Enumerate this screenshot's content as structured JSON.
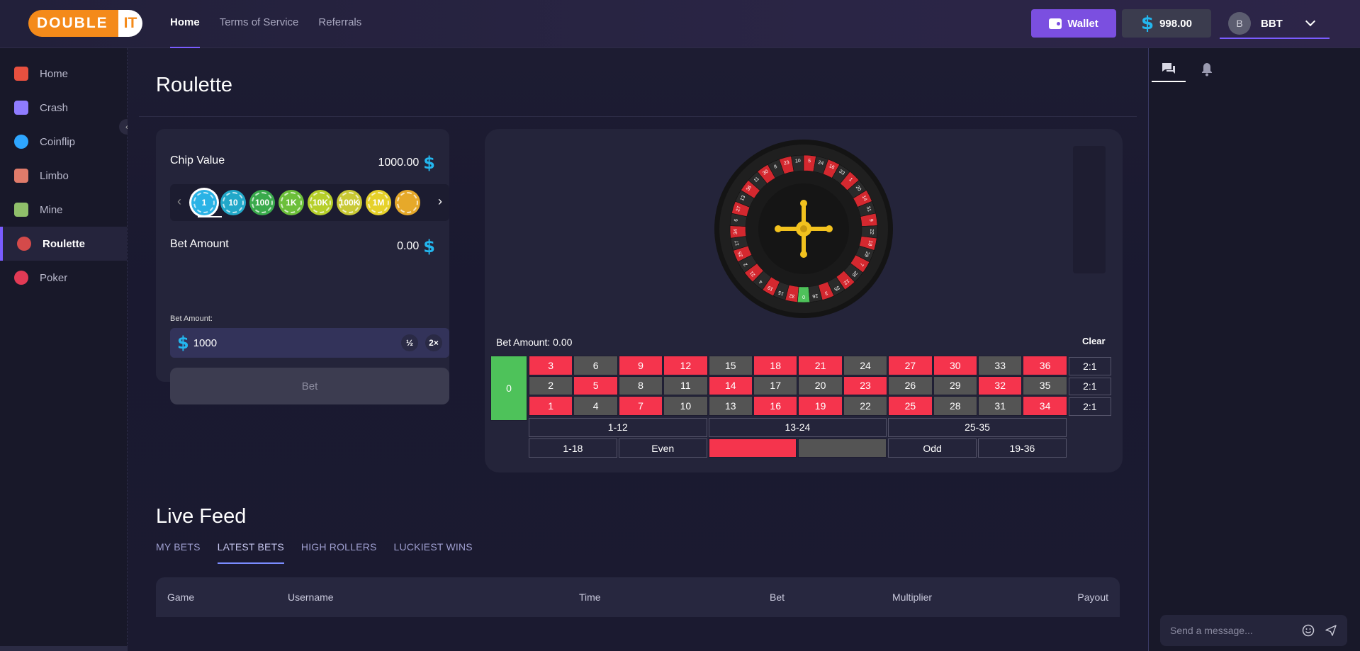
{
  "brand": {
    "logo_main": "DOUBLE",
    "logo_suffix": "IT"
  },
  "topnav": [
    {
      "label": "Home",
      "active": true
    },
    {
      "label": "Terms of Service",
      "active": false
    },
    {
      "label": "Referrals",
      "active": false
    }
  ],
  "header": {
    "wallet_label": "Wallet",
    "currency_symbol": "$",
    "balance": "998.00",
    "avatar_initial": "B",
    "username": "BBT"
  },
  "sidebar": {
    "items": [
      {
        "label": "Home",
        "icon": "house-icon",
        "color": "#e8503f"
      },
      {
        "label": "Crash",
        "icon": "rocket-icon",
        "color": "#8f7cff"
      },
      {
        "label": "Coinflip",
        "icon": "coin-icon",
        "color": "#2ea6ff"
      },
      {
        "label": "Limbo",
        "icon": "rocket-launch-icon",
        "color": "#e07b6a"
      },
      {
        "label": "Mine",
        "icon": "pickaxe-icon",
        "color": "#8fbf6a"
      },
      {
        "label": "Roulette",
        "icon": "roulette-icon",
        "color": "#d44a4a",
        "active": true
      },
      {
        "label": "Poker",
        "icon": "poker-chip-icon",
        "color": "#e23a55"
      }
    ]
  },
  "page": {
    "title": "Roulette"
  },
  "bet_panel": {
    "chip_value_label": "Chip Value",
    "chip_value": "1000.00",
    "chips": [
      {
        "label": "1",
        "color": "#2ab3e6",
        "selected": true
      },
      {
        "label": "10",
        "color": "#22a8c9"
      },
      {
        "label": "100",
        "color": "#3aaa4c"
      },
      {
        "label": "1K",
        "color": "#6cbf3a"
      },
      {
        "label": "10K",
        "color": "#b6cf2a"
      },
      {
        "label": "100K",
        "color": "#c9c935"
      },
      {
        "label": "1M",
        "color": "#e6d12a"
      },
      {
        "label": "",
        "color": "#e6a92a"
      }
    ],
    "bet_amount_label": "Bet Amount",
    "bet_amount": "0.00",
    "input_label": "Bet Amount:",
    "input_value": "1000",
    "half_label": "½",
    "double_label": "2×",
    "bet_button": "Bet"
  },
  "roulette_table": {
    "bet_amount_text": "Bet Amount: 0.00",
    "clear_label": "Clear",
    "zero": "0",
    "rows": [
      [
        {
          "n": "3",
          "c": "red"
        },
        {
          "n": "6",
          "c": "black"
        },
        {
          "n": "9",
          "c": "red"
        },
        {
          "n": "12",
          "c": "red"
        },
        {
          "n": "15",
          "c": "black"
        },
        {
          "n": "18",
          "c": "red"
        },
        {
          "n": "21",
          "c": "red"
        },
        {
          "n": "24",
          "c": "black"
        },
        {
          "n": "27",
          "c": "red"
        },
        {
          "n": "30",
          "c": "red"
        },
        {
          "n": "33",
          "c": "black"
        },
        {
          "n": "36",
          "c": "red"
        }
      ],
      [
        {
          "n": "2",
          "c": "black"
        },
        {
          "n": "5",
          "c": "red"
        },
        {
          "n": "8",
          "c": "black"
        },
        {
          "n": "11",
          "c": "black"
        },
        {
          "n": "14",
          "c": "red"
        },
        {
          "n": "17",
          "c": "black"
        },
        {
          "n": "20",
          "c": "black"
        },
        {
          "n": "23",
          "c": "red"
        },
        {
          "n": "26",
          "c": "black"
        },
        {
          "n": "29",
          "c": "black"
        },
        {
          "n": "32",
          "c": "red"
        },
        {
          "n": "35",
          "c": "black"
        }
      ],
      [
        {
          "n": "1",
          "c": "red"
        },
        {
          "n": "4",
          "c": "black"
        },
        {
          "n": "7",
          "c": "red"
        },
        {
          "n": "10",
          "c": "black"
        },
        {
          "n": "13",
          "c": "black"
        },
        {
          "n": "16",
          "c": "red"
        },
        {
          "n": "19",
          "c": "red"
        },
        {
          "n": "22",
          "c": "black"
        },
        {
          "n": "25",
          "c": "red"
        },
        {
          "n": "28",
          "c": "black"
        },
        {
          "n": "31",
          "c": "black"
        },
        {
          "n": "34",
          "c": "red"
        }
      ]
    ],
    "column_bets": [
      "2:1",
      "2:1",
      "2:1"
    ],
    "dozens": [
      "1-12",
      "13-24",
      "25-35"
    ],
    "outside": [
      {
        "label": "1-18",
        "c": "outline"
      },
      {
        "label": "Even",
        "c": "outline"
      },
      {
        "label": "",
        "c": "red"
      },
      {
        "label": "",
        "c": "black"
      },
      {
        "label": "Odd",
        "c": "outline"
      },
      {
        "label": "19-36",
        "c": "outline"
      }
    ],
    "wheel_numbers": [
      "0",
      "32",
      "15",
      "19",
      "4",
      "21",
      "2",
      "25",
      "17",
      "34",
      "6",
      "27",
      "13",
      "36",
      "11",
      "30",
      "8",
      "23",
      "10",
      "5",
      "24",
      "16",
      "33",
      "1",
      "20",
      "14",
      "31",
      "9",
      "22",
      "18",
      "29",
      "7",
      "28",
      "12",
      "35",
      "3",
      "26"
    ],
    "colors": {
      "red": "#f5344d",
      "black": "#545454",
      "green": "#4ec25a",
      "wheel_red": "#d4282f",
      "wheel_black": "#2a2a2a",
      "cross": "#f2c21e"
    }
  },
  "live_feed": {
    "title": "Live Feed",
    "tabs": [
      {
        "label": "MY BETS",
        "active": false
      },
      {
        "label": "LATEST BETS",
        "active": true
      },
      {
        "label": "HIGH ROLLERS",
        "active": false
      },
      {
        "label": "LUCKIEST WINS",
        "active": false
      }
    ],
    "columns": [
      "Game",
      "Username",
      "Time",
      "Bet",
      "Multiplier",
      "Payout"
    ]
  },
  "chat": {
    "placeholder": "Send a message..."
  }
}
